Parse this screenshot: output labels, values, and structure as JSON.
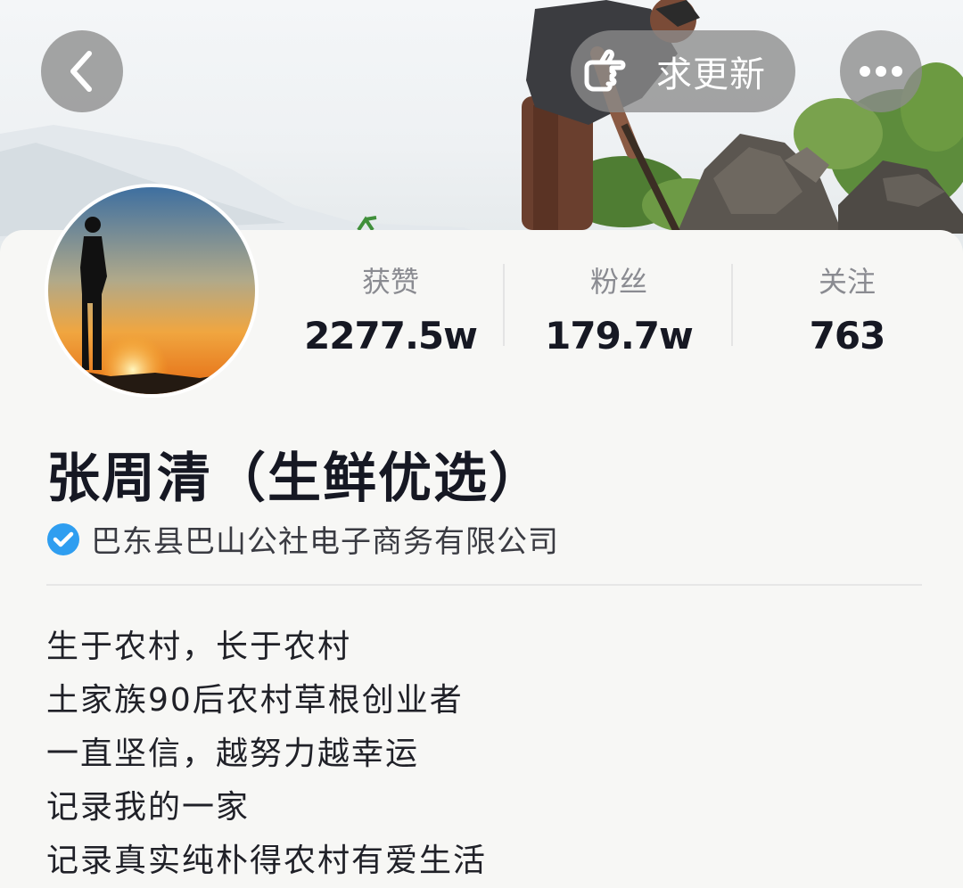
{
  "header": {
    "back_icon": "chevron-left-icon",
    "update_icon": "pointing-hand-icon",
    "update_label": "求更新",
    "more_icon": "ellipsis-icon"
  },
  "profile": {
    "name": "张周清（生鲜优选）",
    "verified_icon": "verified-check-icon",
    "verified_color": "#2f9ef0",
    "organization": "巴东县巴山公社电子商务有限公司"
  },
  "stats": [
    {
      "label": "获赞",
      "value": "2277.5w"
    },
    {
      "label": "粉丝",
      "value": "179.7w"
    },
    {
      "label": "关注",
      "value": "763"
    }
  ],
  "bio": [
    "生于农村，长于农村",
    "土家族90后农村草根创业者",
    "一直坚信，越努力越幸运",
    "记录我的一家",
    "记录真实纯朴得农村有爱生活"
  ]
}
